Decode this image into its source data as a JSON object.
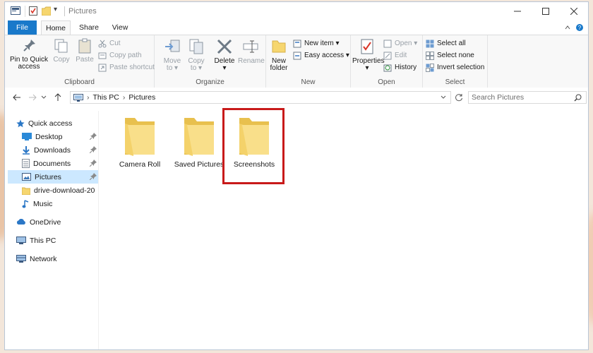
{
  "window": {
    "title": "Pictures",
    "qat_dropdown": "▾"
  },
  "tabs": {
    "file": "File",
    "home": "Home",
    "share": "Share",
    "view": "View"
  },
  "ribbon": {
    "clipboard": {
      "group_label": "Clipboard",
      "pin_to_quick_access": [
        "Pin to Quick",
        "access"
      ],
      "copy": "Copy",
      "paste": "Paste",
      "cut": "Cut",
      "copy_path": "Copy path",
      "paste_shortcut": "Paste shortcut"
    },
    "organize": {
      "group_label": "Organize",
      "move_to": [
        "Move",
        "to ▾"
      ],
      "copy_to": [
        "Copy",
        "to ▾"
      ],
      "delete": [
        "Delete",
        "▾"
      ],
      "rename": "Rename"
    },
    "new": {
      "group_label": "New",
      "new_folder": [
        "New",
        "folder"
      ],
      "new_item": "New item ▾",
      "easy_access": "Easy access ▾"
    },
    "open": {
      "group_label": "Open",
      "properties": [
        "Properties",
        "▾"
      ],
      "open": "Open ▾",
      "edit": "Edit",
      "history": "History"
    },
    "select": {
      "group_label": "Select",
      "select_all": "Select all",
      "select_none": "Select none",
      "invert_selection": "Invert selection"
    }
  },
  "address": {
    "crumbs": [
      "This PC",
      "Pictures"
    ],
    "search_placeholder": "Search Pictures"
  },
  "nav": {
    "quick_access": "Quick access",
    "desktop": "Desktop",
    "downloads": "Downloads",
    "documents": "Documents",
    "pictures": "Pictures",
    "drive_download": "drive-download-20",
    "music": "Music",
    "onedrive": "OneDrive",
    "this_pc": "This PC",
    "network": "Network"
  },
  "folders": [
    {
      "name": "Camera Roll"
    },
    {
      "name": "Saved Pictures"
    },
    {
      "name": "Screenshots"
    }
  ],
  "colors": {
    "accent": "#1979ca",
    "selection": "#cce8ff",
    "highlight_box": "#c81a1a",
    "folder": "#f6d66f"
  }
}
